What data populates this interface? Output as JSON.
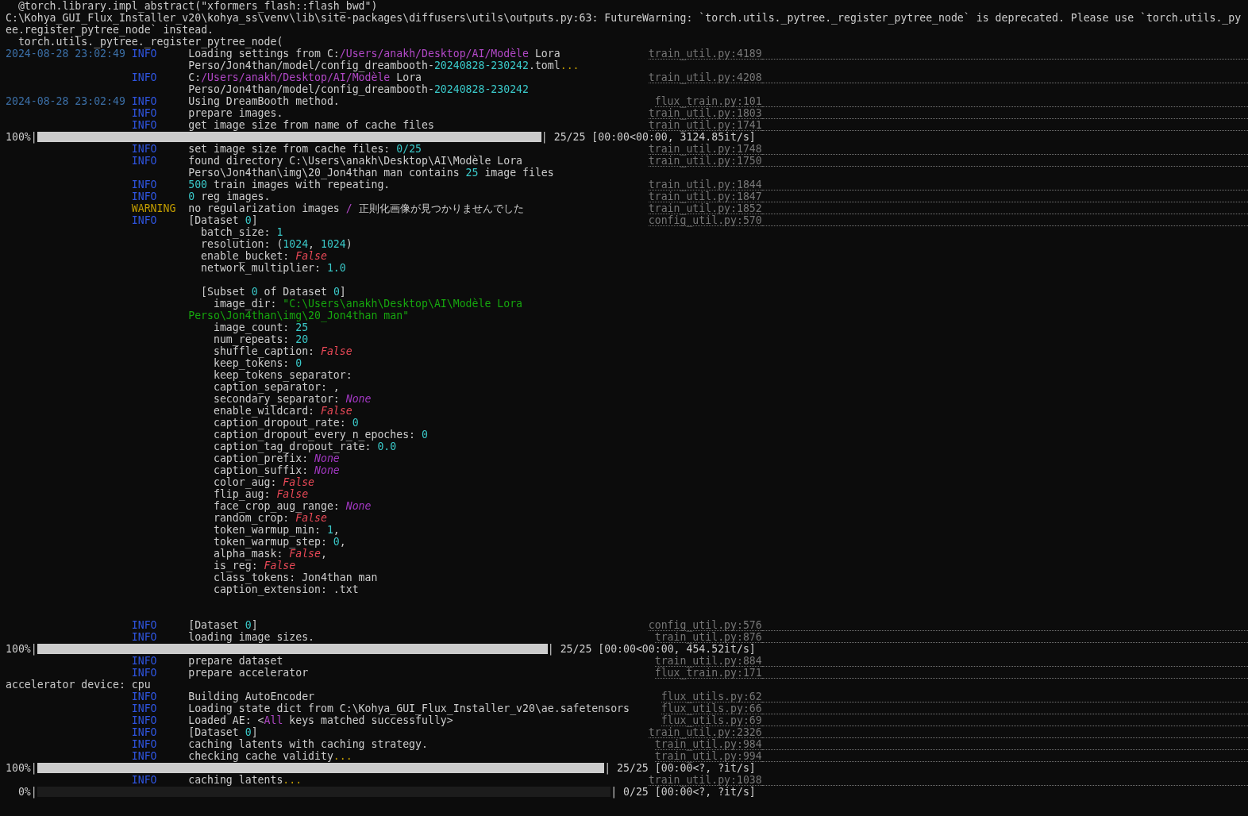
{
  "lines": [
    {
      "kind": "plain",
      "segments": [
        "  @torch.library.impl_abstract(\"xformers_flash::flash_bwd\")"
      ]
    },
    {
      "kind": "plain",
      "segments": [
        "C:\\Kohya_GUI_Flux_Installer_v20\\kohya_ss\\venv\\lib\\site-packages\\diffusers\\utils\\outputs.py:63: FutureWarning: `torch.utils._pytree._register_pytree_node` is deprecated. Please use `torch.utils._py"
      ]
    },
    {
      "kind": "plain",
      "segments": [
        "ee.register_pytree_node` instead."
      ]
    },
    {
      "kind": "plain",
      "segments": [
        "  torch.utils._pytree._register_pytree_node("
      ]
    },
    {
      "kind": "log",
      "time": "2024-08-28 23:02:49",
      "level": "INFO",
      "source": "train_util.py:4189",
      "message": [
        {
          "kind": "text",
          "segments": [
            "Loading settings from C:",
            {
              "text": "/Users/anakh/Desktop/AI/Modèle",
              "kind": "path"
            },
            " Lora"
          ]
        },
        {
          "kind": "text",
          "segments": [
            "Perso/Jon4than/model/config_dreambooth-",
            {
              "text": "20240828-230242",
              "kind": "number"
            },
            ".toml",
            {
              "text": "...",
              "kind": "ellipsis"
            }
          ]
        }
      ]
    },
    {
      "kind": "log",
      "level": "INFO",
      "source": "train_util.py:4208",
      "message": [
        {
          "kind": "text",
          "segments": [
            "C:",
            {
              "text": "/Users/anakh/Desktop/AI/Modèle",
              "kind": "path"
            },
            " Lora"
          ]
        },
        {
          "kind": "text",
          "segments": [
            "Perso/Jon4than/model/config_dreambooth-",
            {
              "text": "20240828-230242",
              "kind": "number"
            }
          ]
        }
      ]
    },
    {
      "kind": "log",
      "time": "2024-08-28 23:02:49",
      "level": "INFO",
      "source": "flux_train.py:101",
      "message": [
        {
          "kind": "text",
          "segments": [
            "Using DreamBooth method."
          ]
        }
      ]
    },
    {
      "kind": "log",
      "level": "INFO",
      "source": "train_util.py:1803",
      "message": [
        {
          "kind": "text",
          "segments": [
            "prepare images."
          ]
        }
      ]
    },
    {
      "kind": "log",
      "level": "INFO",
      "source": "train_util.py:1741",
      "message": [
        {
          "kind": "text",
          "segments": [
            "get image size from name of cache files"
          ]
        }
      ]
    },
    {
      "kind": "progress",
      "prefix": "100%|",
      "level": 1,
      "suffix": "| 25/25 [00:00<00:00, 3124.85it/s]"
    },
    {
      "kind": "log",
      "level": "INFO",
      "source": "train_util.py:1748",
      "message": [
        {
          "kind": "text",
          "segments": [
            "set image size from cache files: ",
            {
              "text": "0/25",
              "kind": "number"
            }
          ]
        }
      ]
    },
    {
      "kind": "log",
      "level": "INFO",
      "source": "train_util.py:1750",
      "message": [
        {
          "kind": "text",
          "segments": [
            "found directory C:\\Users\\anakh\\Desktop\\AI\\Modèle Lora"
          ]
        },
        {
          "kind": "text",
          "segments": [
            "Perso\\Jon4than\\img\\20_Jon4than man contains ",
            {
              "text": "25",
              "kind": "number"
            },
            " image files"
          ]
        }
      ]
    },
    {
      "kind": "log",
      "level": "INFO",
      "source": "train_util.py:1844",
      "message": [
        {
          "kind": "text",
          "segments": [
            {
              "text": "500",
              "kind": "number"
            },
            " train images with repeating."
          ]
        }
      ]
    },
    {
      "kind": "log",
      "level": "INFO",
      "source": "train_util.py:1847",
      "message": [
        {
          "kind": "text",
          "segments": [
            {
              "text": "0",
              "kind": "number"
            },
            " reg images."
          ]
        }
      ]
    },
    {
      "kind": "log",
      "level": "WARNING",
      "source": "train_util.py:1852",
      "message": [
        {
          "kind": "text",
          "segments": [
            "no regularization images ",
            {
              "text": "/",
              "kind": "path"
            },
            " 正則化画像が見つかりませんでした"
          ]
        }
      ]
    },
    {
      "kind": "log",
      "level": "INFO",
      "source": "config_util.py:570",
      "message": [
        {
          "kind": "text",
          "segments": [
            "[Dataset ",
            {
              "text": "0",
              "kind": "number"
            },
            "]"
          ]
        },
        {
          "kind": "text",
          "segments": [
            "  batch_size: ",
            {
              "text": "1",
              "kind": "number"
            }
          ]
        },
        {
          "kind": "text",
          "segments": [
            "  resolution: (",
            {
              "text": "1024",
              "kind": "number"
            },
            ", ",
            {
              "text": "1024",
              "kind": "number"
            },
            ")"
          ]
        },
        {
          "kind": "text",
          "segments": [
            "  enable_bucket: ",
            {
              "text": "False",
              "kind": "false"
            }
          ]
        },
        {
          "kind": "text",
          "segments": [
            "  network_multiplier: ",
            {
              "text": "1.0",
              "kind": "number"
            }
          ]
        },
        {
          "kind": "blank"
        },
        {
          "kind": "text",
          "segments": [
            "  [Subset ",
            {
              "text": "0",
              "kind": "number"
            },
            " of Dataset ",
            {
              "text": "0",
              "kind": "number"
            },
            "]"
          ]
        },
        {
          "kind": "text",
          "segments": [
            "    image_dir: ",
            {
              "text": "\"C:\\Users\\anakh\\Desktop\\AI\\Modèle Lora",
              "kind": "string"
            }
          ]
        },
        {
          "kind": "text",
          "segments": [
            {
              "text": "Perso\\Jon4than\\img\\20_Jon4than man\"",
              "kind": "string"
            }
          ]
        },
        {
          "kind": "text",
          "segments": [
            "    image_count: ",
            {
              "text": "25",
              "kind": "number"
            }
          ]
        },
        {
          "kind": "text",
          "segments": [
            "    num_repeats: ",
            {
              "text": "20",
              "kind": "number"
            }
          ]
        },
        {
          "kind": "text",
          "segments": [
            "    shuffle_caption: ",
            {
              "text": "False",
              "kind": "false"
            }
          ]
        },
        {
          "kind": "text",
          "segments": [
            "    keep_tokens: ",
            {
              "text": "0",
              "kind": "number"
            }
          ]
        },
        {
          "kind": "text",
          "segments": [
            "    keep_tokens_separator:"
          ]
        },
        {
          "kind": "text",
          "segments": [
            "    caption_separator: ,"
          ]
        },
        {
          "kind": "text",
          "segments": [
            "    secondary_separator: ",
            {
              "text": "None",
              "kind": "none"
            }
          ]
        },
        {
          "kind": "text",
          "segments": [
            "    enable_wildcard: ",
            {
              "text": "False",
              "kind": "false"
            }
          ]
        },
        {
          "kind": "text",
          "segments": [
            "    caption_dropout_rate: ",
            {
              "text": "0",
              "kind": "number"
            }
          ]
        },
        {
          "kind": "text",
          "segments": [
            "    caption_dropout_every_n_epoches: ",
            {
              "text": "0",
              "kind": "number"
            }
          ]
        },
        {
          "kind": "text",
          "segments": [
            "    caption_tag_dropout_rate: ",
            {
              "text": "0.0",
              "kind": "number"
            }
          ]
        },
        {
          "kind": "text",
          "segments": [
            "    caption_prefix: ",
            {
              "text": "None",
              "kind": "none"
            }
          ]
        },
        {
          "kind": "text",
          "segments": [
            "    caption_suffix: ",
            {
              "text": "None",
              "kind": "none"
            }
          ]
        },
        {
          "kind": "text",
          "segments": [
            "    color_aug: ",
            {
              "text": "False",
              "kind": "false"
            }
          ]
        },
        {
          "kind": "text",
          "segments": [
            "    flip_aug: ",
            {
              "text": "False",
              "kind": "false"
            }
          ]
        },
        {
          "kind": "text",
          "segments": [
            "    face_crop_aug_range: ",
            {
              "text": "None",
              "kind": "none"
            }
          ]
        },
        {
          "kind": "text",
          "segments": [
            "    random_crop: ",
            {
              "text": "False",
              "kind": "false"
            }
          ]
        },
        {
          "kind": "text",
          "segments": [
            "    token_warmup_min: ",
            {
              "text": "1",
              "kind": "number"
            },
            ","
          ]
        },
        {
          "kind": "text",
          "segments": [
            "    token_warmup_step: ",
            {
              "text": "0",
              "kind": "number"
            },
            ","
          ]
        },
        {
          "kind": "text",
          "segments": [
            "    alpha_mask: ",
            {
              "text": "False",
              "kind": "false"
            },
            ","
          ]
        },
        {
          "kind": "text",
          "segments": [
            "    is_reg: ",
            {
              "text": "False",
              "kind": "false"
            }
          ]
        },
        {
          "kind": "text",
          "segments": [
            "    class_tokens: Jon4than man"
          ]
        },
        {
          "kind": "text",
          "segments": [
            "    caption_extension: .txt"
          ]
        },
        {
          "kind": "blank"
        },
        {
          "kind": "blank"
        }
      ]
    },
    {
      "kind": "log",
      "level": "INFO",
      "source": "config_util.py:576",
      "message": [
        {
          "kind": "text",
          "segments": [
            "[Dataset ",
            {
              "text": "0",
              "kind": "number"
            },
            "]"
          ]
        }
      ]
    },
    {
      "kind": "log",
      "level": "INFO",
      "source": "train_util.py:876",
      "message": [
        {
          "kind": "text",
          "segments": [
            "loading image sizes."
          ]
        }
      ]
    },
    {
      "kind": "progress",
      "prefix": "100%|",
      "level": 1,
      "suffix": "| 25/25 [00:00<00:00, 454.52it/s]"
    },
    {
      "kind": "log",
      "level": "INFO",
      "source": "train_util.py:884",
      "message": [
        {
          "kind": "text",
          "segments": [
            "prepare dataset"
          ]
        }
      ]
    },
    {
      "kind": "log",
      "level": "INFO",
      "source": "flux_train.py:171",
      "message": [
        {
          "kind": "text",
          "segments": [
            "prepare accelerator"
          ]
        }
      ]
    },
    {
      "kind": "plain",
      "segments": [
        "accelerator device: cpu"
      ]
    },
    {
      "kind": "log",
      "level": "INFO",
      "source": "flux_utils.py:62",
      "message": [
        {
          "kind": "text",
          "segments": [
            "Building AutoEncoder"
          ]
        }
      ]
    },
    {
      "kind": "log",
      "level": "INFO",
      "source": "flux_utils.py:66",
      "message": [
        {
          "kind": "text",
          "segments": [
            "Loading state dict from C:\\Kohya_GUI_Flux_Installer_v20\\ae.safetensors"
          ]
        }
      ]
    },
    {
      "kind": "log",
      "level": "INFO",
      "source": "flux_utils.py:69",
      "message": [
        {
          "kind": "text",
          "segments": [
            "Loaded AE: <",
            {
              "text": "All",
              "kind": "path"
            },
            " keys matched successfully>"
          ]
        }
      ]
    },
    {
      "kind": "log",
      "level": "INFO",
      "source": "train_util.py:2326",
      "message": [
        {
          "kind": "text",
          "segments": [
            "[Dataset ",
            {
              "text": "0",
              "kind": "number"
            },
            "]"
          ]
        }
      ]
    },
    {
      "kind": "log",
      "level": "INFO",
      "source": "train_util.py:984",
      "message": [
        {
          "kind": "text",
          "segments": [
            "caching latents with caching strategy."
          ]
        }
      ]
    },
    {
      "kind": "log",
      "level": "INFO",
      "source": "train_util.py:994",
      "message": [
        {
          "kind": "text",
          "segments": [
            "checking cache validity",
            {
              "text": "...",
              "kind": "ellipsis"
            }
          ]
        }
      ]
    },
    {
      "kind": "progress",
      "prefix": "100%|",
      "level": 1,
      "suffix": "| 25/25 [00:00<?, ?it/s]"
    },
    {
      "kind": "log",
      "level": "INFO",
      "source": "train_util.py:1038",
      "message": [
        {
          "kind": "text",
          "segments": [
            "caching latents",
            {
              "text": "...",
              "kind": "ellipsis"
            }
          ]
        }
      ]
    },
    {
      "kind": "progress",
      "prefix": "  0%|",
      "level": 0,
      "suffix": "| 0/25 [00:00<?, ?it/s]"
    }
  ]
}
